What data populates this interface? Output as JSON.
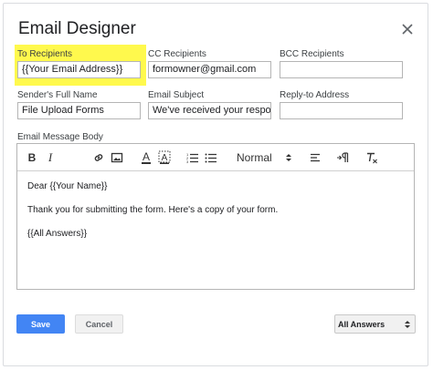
{
  "dialog": {
    "title": "Email Designer",
    "close_icon": "close-icon"
  },
  "fields": {
    "to_recipients": {
      "label": "To Recipients",
      "value": "{{Your Email Address}}",
      "highlight_color": "#fff94d"
    },
    "cc_recipients": {
      "label": "CC Recipients",
      "value": "formowner@gmail.com"
    },
    "bcc_recipients": {
      "label": "BCC Recipients",
      "value": ""
    },
    "sender_full_name": {
      "label": "Sender's Full Name",
      "value": "File Upload Forms"
    },
    "email_subject": {
      "label": "Email Subject",
      "value": "We've received your respose"
    },
    "reply_to_address": {
      "label": "Reply-to Address",
      "value": ""
    }
  },
  "editor": {
    "label": "Email Message Body",
    "toolbar": {
      "icons": [
        "bold-icon",
        "italic-icon",
        "link-icon",
        "image-icon",
        "text-color-icon",
        "background-color-icon",
        "numbered-list-icon",
        "bulleted-list-icon",
        "align-icon",
        "text-direction-icon",
        "clear-formatting-icon"
      ],
      "bold": "B",
      "italic": "I",
      "text_color": "A",
      "format_value": "Normal"
    },
    "body_lines": [
      "Dear {{Your Name}}",
      "Thank you for submitting the form. Here's a copy of your form.",
      "{{All Answers}}"
    ]
  },
  "footer": {
    "save_label": "Save",
    "cancel_label": "Cancel",
    "insert_select_value": "All Answers"
  },
  "colors": {
    "primary_button": "#4285f4",
    "highlight": "#fff94d"
  }
}
